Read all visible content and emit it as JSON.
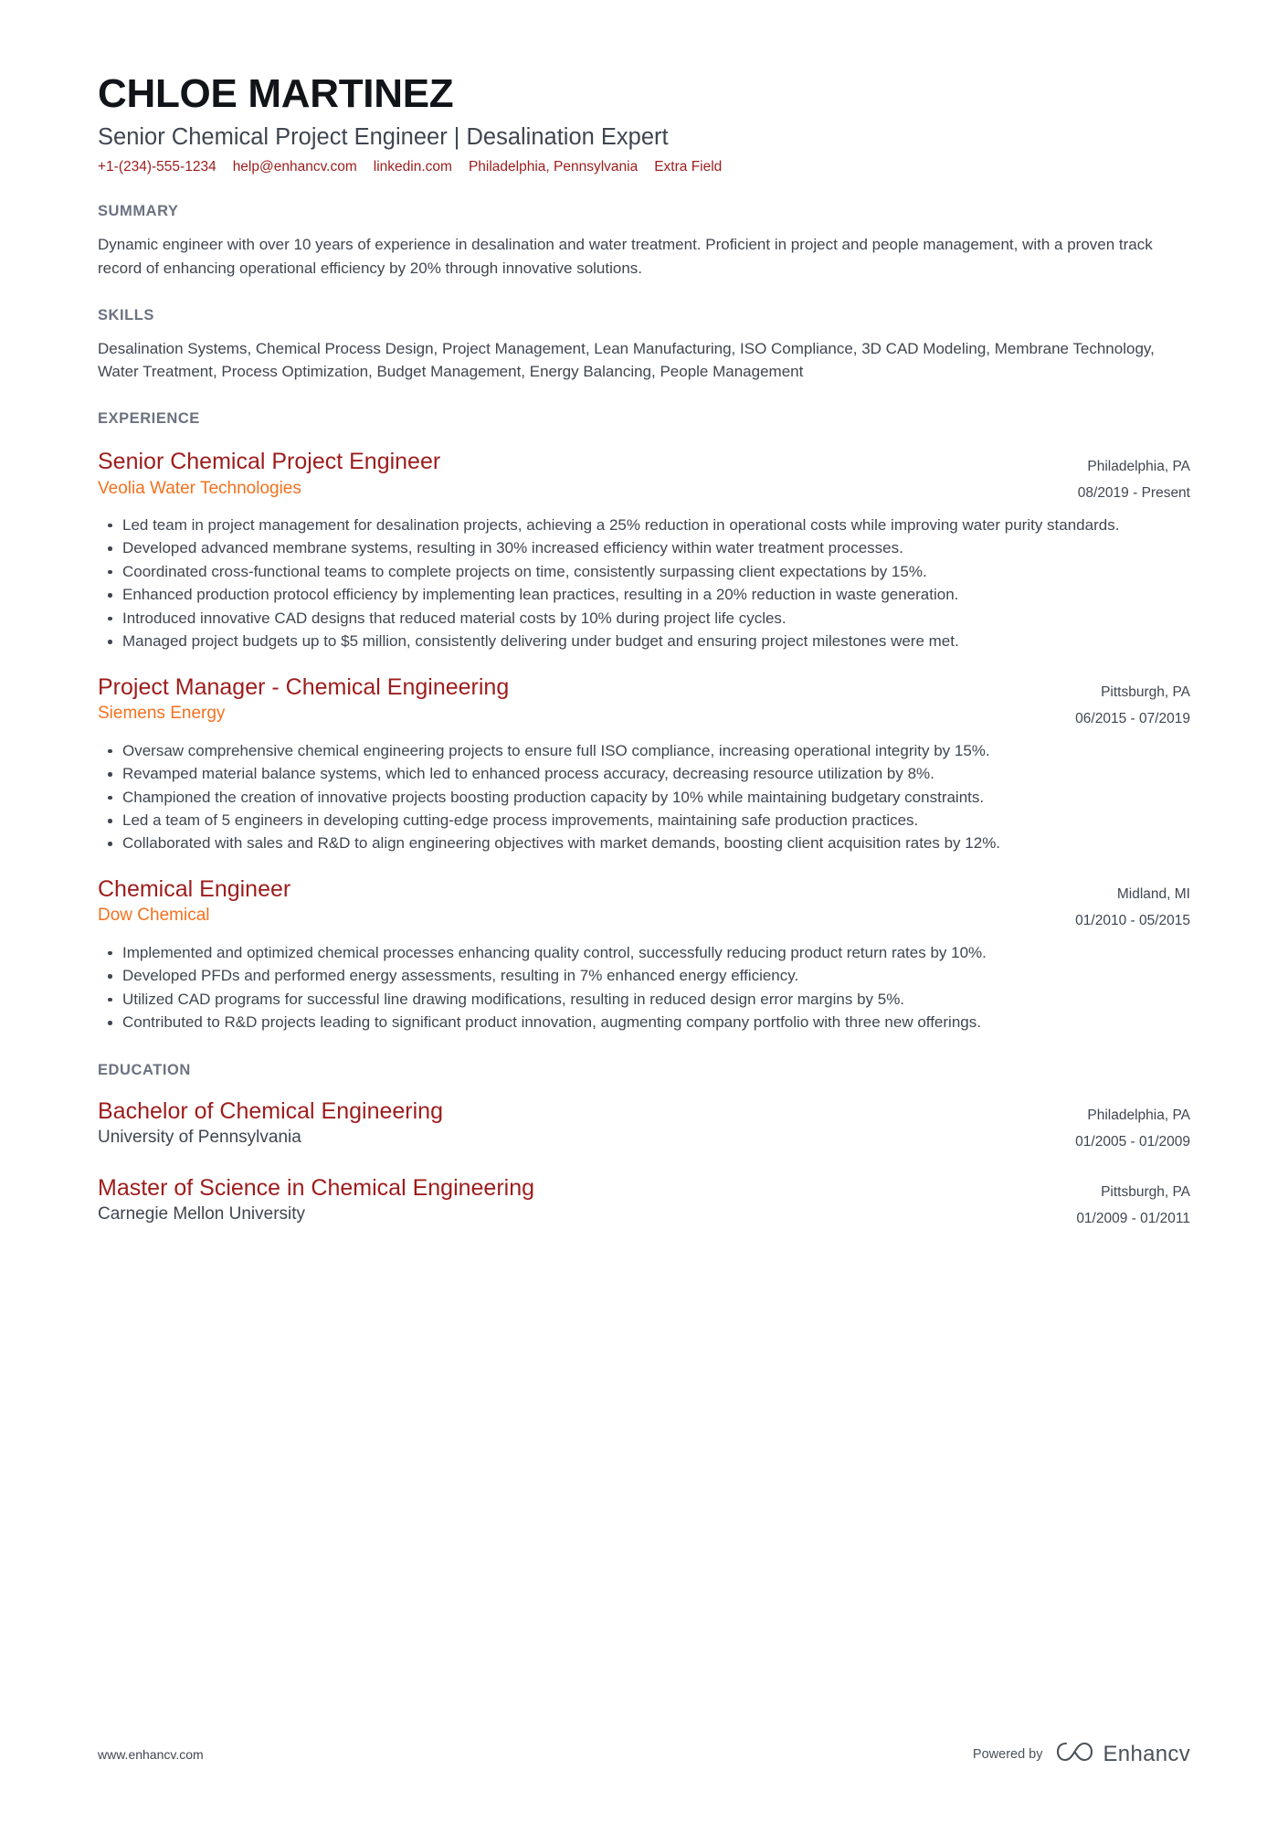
{
  "header": {
    "name": "CHLOE MARTINEZ",
    "headline": "Senior Chemical Project Engineer | Desalination Expert",
    "contacts": [
      "+1-(234)-555-1234",
      "help@enhancv.com",
      "linkedin.com",
      "Philadelphia, Pennsylvania",
      "Extra Field"
    ]
  },
  "summary": {
    "title": "SUMMARY",
    "text": "Dynamic engineer with over 10 years of experience in desalination and water treatment. Proficient in project and people management, with a proven track record of enhancing operational efficiency by 20% through innovative solutions."
  },
  "skills": {
    "title": "SKILLS",
    "text": "Desalination Systems, Chemical Process Design, Project Management, Lean Manufacturing, ISO Compliance, 3D CAD Modeling, Membrane Technology, Water Treatment, Process Optimization, Budget Management, Energy Balancing, People Management"
  },
  "experience": {
    "title": "EXPERIENCE",
    "entries": [
      {
        "role": "Senior Chemical Project Engineer",
        "company": "Veolia Water Technologies",
        "location": "Philadelphia, PA",
        "dates": "08/2019 - Present",
        "bullets": [
          "Led team in project management for desalination projects, achieving a 25% reduction in operational costs while improving water purity standards.",
          "Developed advanced membrane systems, resulting in 30% increased efficiency within water treatment processes.",
          "Coordinated cross-functional teams to complete projects on time, consistently surpassing client expectations by 15%.",
          "Enhanced production protocol efficiency by implementing lean practices, resulting in a 20% reduction in waste generation.",
          "Introduced innovative CAD designs that reduced material costs by 10% during project life cycles.",
          "Managed project budgets up to $5 million, consistently delivering under budget and ensuring project milestones were met."
        ]
      },
      {
        "role": "Project Manager - Chemical Engineering",
        "company": "Siemens Energy",
        "location": "Pittsburgh, PA",
        "dates": "06/2015 - 07/2019",
        "bullets": [
          "Oversaw comprehensive chemical engineering projects to ensure full ISO compliance, increasing operational integrity by 15%.",
          "Revamped material balance systems, which led to enhanced process accuracy, decreasing resource utilization by 8%.",
          "Championed the creation of innovative projects boosting production capacity by 10% while maintaining budgetary constraints.",
          "Led a team of 5 engineers in developing cutting-edge process improvements, maintaining safe production practices.",
          "Collaborated with sales and R&D to align engineering objectives with market demands, boosting client acquisition rates by 12%."
        ]
      },
      {
        "role": "Chemical Engineer",
        "company": "Dow Chemical",
        "location": "Midland, MI",
        "dates": "01/2010 - 05/2015",
        "bullets": [
          "Implemented and optimized chemical processes enhancing quality control, successfully reducing product return rates by 10%.",
          "Developed PFDs and performed energy assessments, resulting in 7% enhanced energy efficiency.",
          "Utilized CAD programs for successful line drawing modifications, resulting in reduced design error margins by 5%.",
          "Contributed to R&D projects leading to significant product innovation, augmenting company portfolio with three new offerings."
        ]
      }
    ]
  },
  "education": {
    "title": "EDUCATION",
    "entries": [
      {
        "degree": "Bachelor of Chemical Engineering",
        "school": "University of Pennsylvania",
        "location": "Philadelphia, PA",
        "dates": "01/2005 - 01/2009"
      },
      {
        "degree": "Master of Science in Chemical Engineering",
        "school": "Carnegie Mellon University",
        "location": "Pittsburgh, PA",
        "dates": "01/2009 - 01/2011"
      }
    ]
  },
  "footer": {
    "url": "www.enhancv.com",
    "powered_by": "Powered by",
    "brand": "Enhancv"
  },
  "colors": {
    "accent_red": "#9d1c1c",
    "accent_orange": "#f4711f",
    "heading_gray": "#6b7280",
    "body_gray": "#3f4650",
    "name_black": "#111418"
  }
}
